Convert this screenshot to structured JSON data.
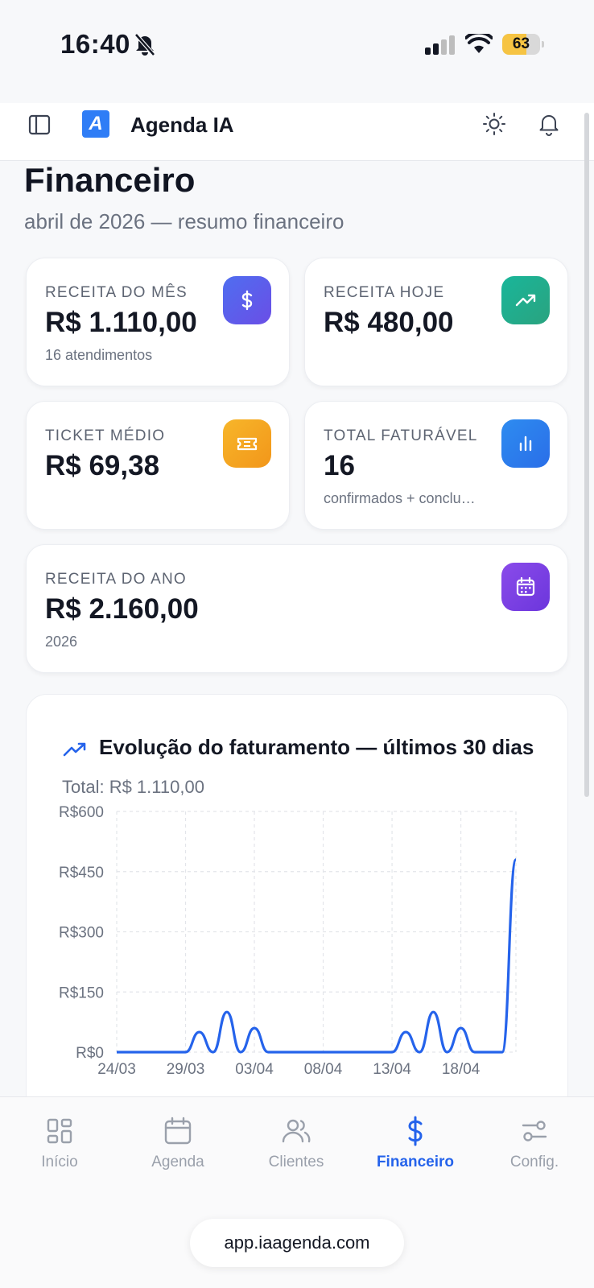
{
  "status_bar": {
    "time": "16:40",
    "battery": "63",
    "battery_level": 0.63
  },
  "header": {
    "app_title": "Agenda IA",
    "logo_letter": "A"
  },
  "page": {
    "title": "Financeiro",
    "subtitle": "abril de 2026 — resumo financeiro"
  },
  "cards": {
    "month": {
      "label": "RECEITA DO MÊS",
      "value": "R$ 1.110,00",
      "sub": "16 atendimentos",
      "icon": "dollar-icon",
      "color": "#5b55e8"
    },
    "today": {
      "label": "RECEITA HOJE",
      "value": "R$ 480,00",
      "sub": "",
      "icon": "trending-up-icon",
      "color": "#22b08f"
    },
    "ticket": {
      "label": "TICKET MÉDIO",
      "value": "R$ 69,38",
      "sub": "",
      "icon": "ticket-icon",
      "color": "#f5a61c"
    },
    "billable": {
      "label": "TOTAL FATURÁVEL",
      "value": "16",
      "sub": "confirmados + conclu…",
      "icon": "bar-chart-icon",
      "color": "#2f80f0"
    },
    "year": {
      "label": "RECEITA DO ANO",
      "value": "R$ 2.160,00",
      "sub": "2026",
      "icon": "calendar-icon",
      "color": "#7b3fe4"
    }
  },
  "chart": {
    "title": "Evolução do faturamento — últimos 30 dias",
    "total": "Total: R$ 1.110,00"
  },
  "chart_data": {
    "type": "line",
    "title": "Evolução do faturamento — últimos 30 dias",
    "xlabel": "",
    "ylabel": "",
    "x_tick_labels": [
      "24/03",
      "29/03",
      "03/04",
      "08/04",
      "13/04",
      "18/04"
    ],
    "y_tick_labels": [
      "R$600",
      "R$450",
      "R$300",
      "R$150",
      "R$0"
    ],
    "ylim": [
      0,
      600
    ],
    "grid": true,
    "color": "#2563eb",
    "x": [
      "24/03",
      "25/03",
      "26/03",
      "27/03",
      "28/03",
      "29/03",
      "30/03",
      "31/03",
      "01/04",
      "02/04",
      "03/04",
      "04/04",
      "05/04",
      "06/04",
      "07/04",
      "08/04",
      "09/04",
      "10/04",
      "11/04",
      "12/04",
      "13/04",
      "14/04",
      "15/04",
      "16/04",
      "17/04",
      "18/04",
      "19/04",
      "20/04",
      "21/04",
      "22/04"
    ],
    "values": [
      0,
      0,
      0,
      0,
      0,
      0,
      50,
      0,
      100,
      0,
      60,
      0,
      0,
      0,
      0,
      0,
      0,
      0,
      0,
      0,
      0,
      50,
      0,
      100,
      0,
      60,
      0,
      0,
      0,
      480
    ]
  },
  "nav": {
    "items": [
      {
        "label": "Início",
        "icon": "grid-icon"
      },
      {
        "label": "Agenda",
        "icon": "calendar-icon"
      },
      {
        "label": "Clientes",
        "icon": "users-icon"
      },
      {
        "label": "Financeiro",
        "icon": "dollar-icon"
      },
      {
        "label": "Config.",
        "icon": "sliders-icon"
      }
    ],
    "active_color": "#2563eb",
    "inactive_color": "#9aa0ab"
  },
  "browser": {
    "url": "app.iaagenda.com"
  }
}
